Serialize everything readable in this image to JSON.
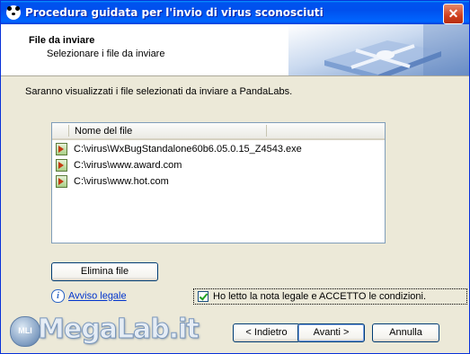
{
  "window": {
    "title": "Procedura guidata per l'invio di virus sconosciuti",
    "close_label": "✕"
  },
  "header": {
    "title": "File da inviare",
    "subtitle": "Selezionare i file da inviare"
  },
  "intro_text": "Saranno visualizzati i file selezionati da inviare a PandaLabs.",
  "file_list": {
    "column_header": "Nome del file",
    "files": [
      "C:\\virus\\WxBugStandalone60b6.05.0.15_Z4543.exe",
      "C:\\virus\\www.award.com",
      "C:\\virus\\www.hot.com"
    ]
  },
  "buttons": {
    "remove_file": "Elimina file",
    "back": "< Indietro",
    "next": "Avanti >",
    "cancel": "Annulla"
  },
  "legal": {
    "link_text": "Avviso legale",
    "accept_label": "Ho letto la nota legale e ACCETTO le condizioni.",
    "accepted": true
  },
  "watermark": {
    "text": "MegaLab.it",
    "badge_text": "MLI"
  },
  "icons": {
    "app": "panda-icon",
    "info": "info-icon",
    "file": "file-submit-icon"
  }
}
